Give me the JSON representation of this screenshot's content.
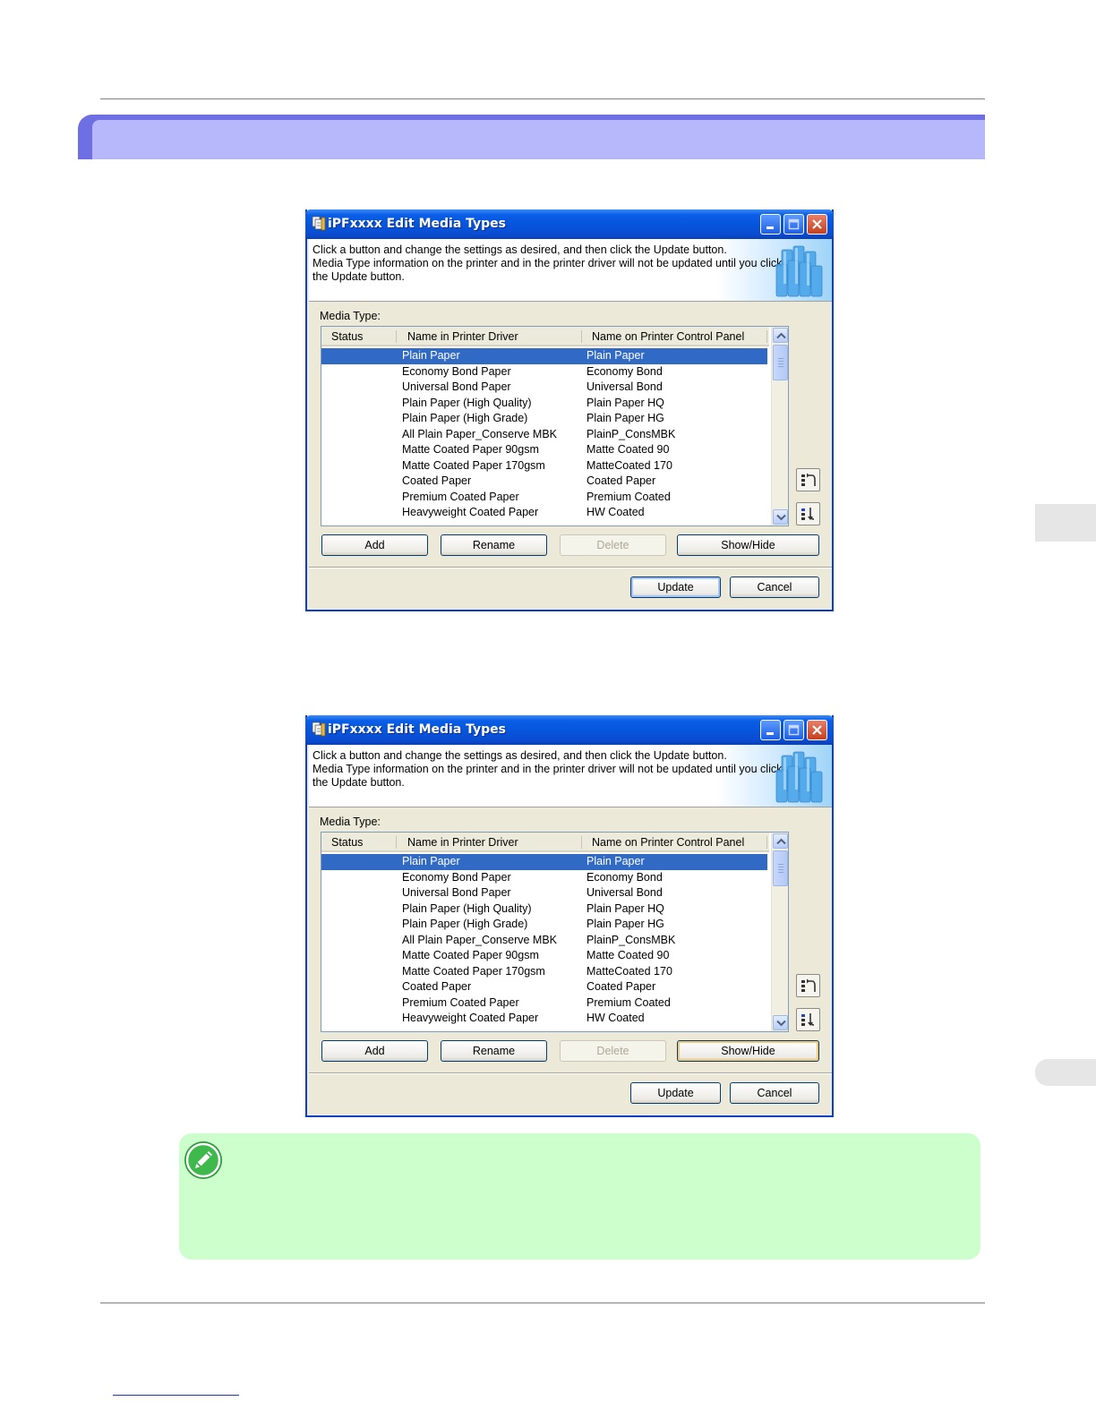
{
  "dialogs": [
    {
      "title": "iPFxxxx Edit Media Types",
      "instructions": "Click a button and change the settings as desired, and then click the Update button.\nMedia Type information on the printer and in the printer driver will not be updated until you click\nthe Update button.",
      "media_type_label": "Media Type:",
      "columns": [
        "Status",
        "Name in Printer Driver",
        "Name on Printer Control Panel"
      ],
      "rows": [
        {
          "driver": "Plain Paper",
          "panel": "Plain Paper",
          "selected": true
        },
        {
          "driver": "Economy Bond Paper",
          "panel": "Economy Bond"
        },
        {
          "driver": "Universal Bond Paper",
          "panel": "Universal Bond"
        },
        {
          "driver": "Plain Paper (High Quality)",
          "panel": "Plain Paper HQ"
        },
        {
          "driver": "Plain Paper (High Grade)",
          "panel": "Plain Paper HG"
        },
        {
          "driver": "All Plain Paper_Conserve MBK",
          "panel": "PlainP_ConsMBK"
        },
        {
          "driver": "Matte Coated Paper 90gsm",
          "panel": "Matte Coated 90"
        },
        {
          "driver": "Matte Coated Paper 170gsm",
          "panel": "MatteCoated 170"
        },
        {
          "driver": "Coated Paper",
          "panel": "Coated Paper"
        },
        {
          "driver": "Premium Coated Paper",
          "panel": "Premium Coated"
        },
        {
          "driver": "Heavyweight Coated Paper",
          "panel": "HW Coated"
        }
      ],
      "buttons": {
        "add": "Add",
        "rename": "Rename",
        "delete": "Delete",
        "show_hide": "Show/Hide",
        "update": "Update",
        "cancel": "Cancel"
      }
    },
    {
      "title": "iPFxxxx Edit Media Types",
      "instructions": "Click a button and change the settings as desired, and then click the Update button.\nMedia Type information on the printer and in the printer driver will not be updated until you click\nthe Update button.",
      "media_type_label": "Media Type:",
      "columns": [
        "Status",
        "Name in Printer Driver",
        "Name on Printer Control Panel"
      ],
      "rows": [
        {
          "driver": "Plain Paper",
          "panel": "Plain Paper",
          "selected": true
        },
        {
          "driver": "Economy Bond Paper",
          "panel": "Economy Bond"
        },
        {
          "driver": "Universal Bond Paper",
          "panel": "Universal Bond"
        },
        {
          "driver": "Plain Paper (High Quality)",
          "panel": "Plain Paper HQ"
        },
        {
          "driver": "Plain Paper (High Grade)",
          "panel": "Plain Paper HG"
        },
        {
          "driver": "All Plain Paper_Conserve MBK",
          "panel": "PlainP_ConsMBK"
        },
        {
          "driver": "Matte Coated Paper 90gsm",
          "panel": "Matte Coated 90"
        },
        {
          "driver": "Matte Coated Paper 170gsm",
          "panel": "MatteCoated 170"
        },
        {
          "driver": "Coated Paper",
          "panel": "Coated Paper"
        },
        {
          "driver": "Premium Coated Paper",
          "panel": "Premium Coated"
        },
        {
          "driver": "Heavyweight Coated Paper",
          "panel": "HW Coated"
        }
      ],
      "buttons": {
        "add": "Add",
        "rename": "Rename",
        "delete": "Delete",
        "show_hide": "Show/Hide",
        "update": "Update",
        "cancel": "Cancel"
      },
      "focused_button": "show_hide"
    }
  ],
  "icons": {
    "title_icon": "printer-media-icon",
    "banner_art": "paper-stack-icon",
    "move_up": "move-up-icon",
    "move_down": "move-down-icon",
    "note": "note-pencil-icon"
  },
  "colors": {
    "section_band": "#b6b8fb",
    "section_band_edge": "#6f6fe4",
    "note_background": "#ccffcc",
    "selection": "#316ac5",
    "titlebar": "#0654dc"
  }
}
